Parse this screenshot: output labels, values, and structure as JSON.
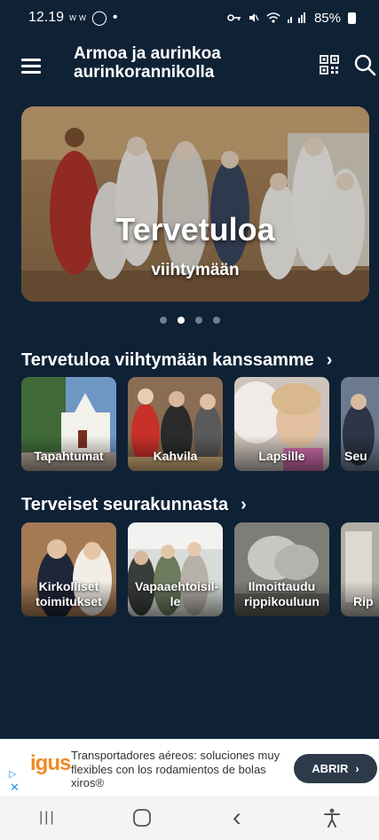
{
  "status_bar": {
    "time": "12.19",
    "notif_glyphs": "ᴡ ᴡ",
    "whatsapp_glyph": "◯",
    "dot": "•",
    "battery": "85%"
  },
  "header": {
    "title": "Armoa ja aurinkoa aurinkorannikolla",
    "menu_icon": "hamburger-menu-icon",
    "qr_icon": "qr-code-icon",
    "search_icon": "search-icon"
  },
  "hero": {
    "title": "Tervetuloa",
    "subtitle": "viihtymään",
    "active_dot": 1,
    "dot_count": 4
  },
  "section1": {
    "heading": "Tervetuloa viihtymään kanssamme",
    "chevron": "›",
    "cards": [
      {
        "label": "Tapahtumat",
        "bg": "#6d8fb0"
      },
      {
        "label": "Kahvila",
        "bg": "#7a6048"
      },
      {
        "label": "Lapsille",
        "bg": "#c9b7a8"
      },
      {
        "label": "Seu",
        "bg": "#5a6a80"
      }
    ]
  },
  "section2": {
    "heading": "Terveiset seurakunnasta",
    "chevron": "›",
    "cards": [
      {
        "label": "Kirkolliset toimitukset",
        "bg": "#8a6a4e"
      },
      {
        "label": "Vapaaehtoisil-le",
        "bg": "#6e7a70"
      },
      {
        "label": "Ilmoittaudu rippikouluun",
        "bg": "#8c8d88"
      },
      {
        "label": "Rip",
        "bg": "#9a9a94"
      }
    ]
  },
  "ad": {
    "logo": "igus",
    "text": "Transportadores aéreos: soluciones muy flexibles con los rodamientos de bolas xiros®",
    "button": "ABRIR",
    "button_chevron": "›"
  },
  "nav": {
    "recents": "|||",
    "home": "○",
    "back": "‹",
    "accessibility": "accessibility-icon"
  },
  "colors": {
    "background": "#0f2135",
    "text": "#ffffff",
    "ad_button": "#2d3a4a"
  }
}
